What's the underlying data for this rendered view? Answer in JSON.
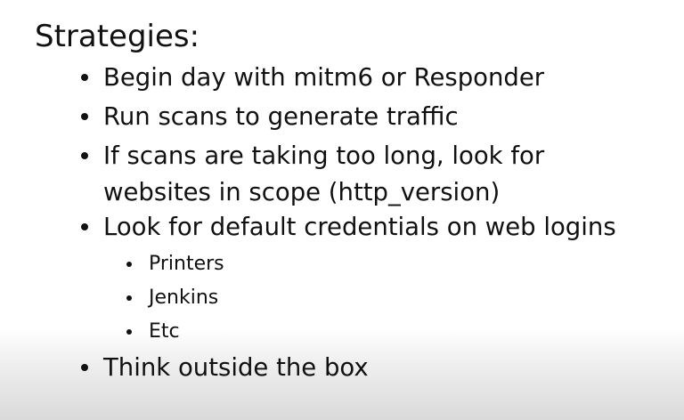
{
  "slide": {
    "title": "Strategies:",
    "bullets": [
      {
        "lines": [
          "Begin day with mitm6 or Responder"
        ]
      },
      {
        "lines": [
          "Run scans to generate traffic"
        ]
      },
      {
        "lines": [
          "If scans are taking too long, look for",
          "websites in scope (http_version)"
        ]
      },
      {
        "lines": [
          "Look for default credentials on web logins"
        ]
      },
      {
        "sub": [
          "Printers",
          "Jenkins",
          "Etc"
        ]
      },
      {
        "lines": [
          "Think outside the box"
        ]
      }
    ]
  }
}
